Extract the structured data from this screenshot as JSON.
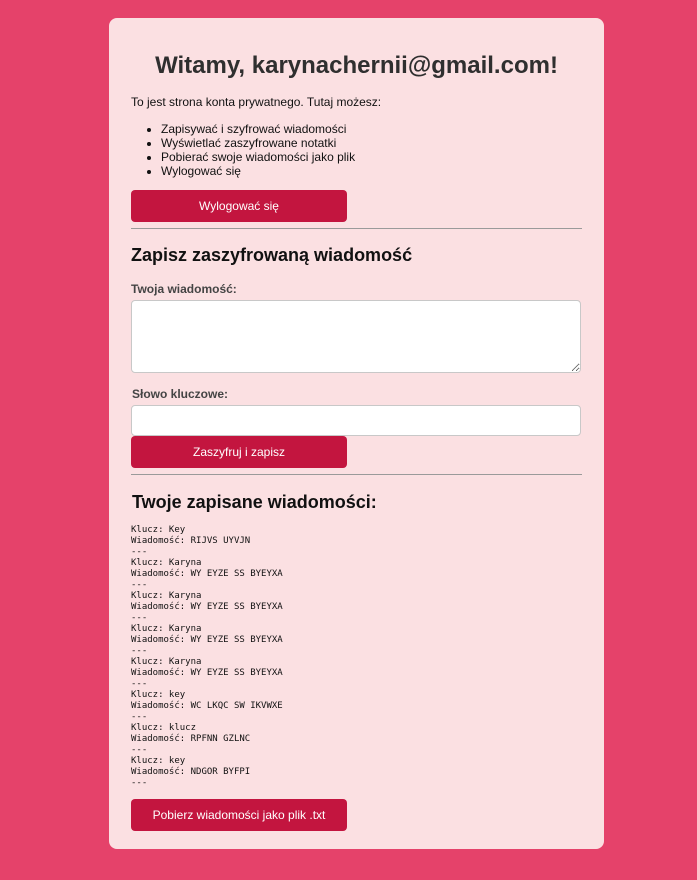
{
  "header": {
    "title": "Witamy, karynachernii@gmail.com!"
  },
  "intro": {
    "text": "To jest strona konta prywatnego. Tutaj możesz:",
    "features": [
      "Zapisywać i szyfrować wiadomości",
      "Wyświetlać zaszyfrowane notatki",
      "Pobierać swoje wiadomości jako plik",
      "Wylogować się"
    ]
  },
  "logout_button": "Wylogować się",
  "save_section": {
    "title": "Zapisz zaszyfrowaną wiadomość",
    "message_label": "Twoja wiadomość:",
    "message_value": "",
    "key_label": "Słowo kluczowe:",
    "key_value": "",
    "submit_label": "Zaszyfruj i zapisz"
  },
  "saved_section": {
    "title": "Twoje zapisane wiadomości:",
    "entries": [
      {
        "key_line": "Klucz: Key",
        "message_line": "Wiadomość: RIJVS UYVJN",
        "separator": "---"
      },
      {
        "key_line": "Klucz: Karyna",
        "message_line": "Wiadomość: WY EYZE SS BYEYXA",
        "separator": "---"
      },
      {
        "key_line": "Klucz: Karyna",
        "message_line": "Wiadomość: WY EYZE SS BYEYXA",
        "separator": "---"
      },
      {
        "key_line": "Klucz: Karyna",
        "message_line": "Wiadomość: WY EYZE SS BYEYXA",
        "separator": "---"
      },
      {
        "key_line": "Klucz: Karyna",
        "message_line": "Wiadomość: WY EYZE SS BYEYXA",
        "separator": "---"
      },
      {
        "key_line": "Klucz: key",
        "message_line": "Wiadomość: WC LKQC SW IKVWXE",
        "separator": "---"
      },
      {
        "key_line": "Klucz: klucz",
        "message_line": "Wiadomość: RPFNN GZLNC",
        "separator": "---"
      },
      {
        "key_line": "Klucz: key",
        "message_line": "Wiadomość: NDGOR BYFPI",
        "separator": "---"
      }
    ],
    "download_label": "Pobierz wiadomości jako plik .txt"
  }
}
